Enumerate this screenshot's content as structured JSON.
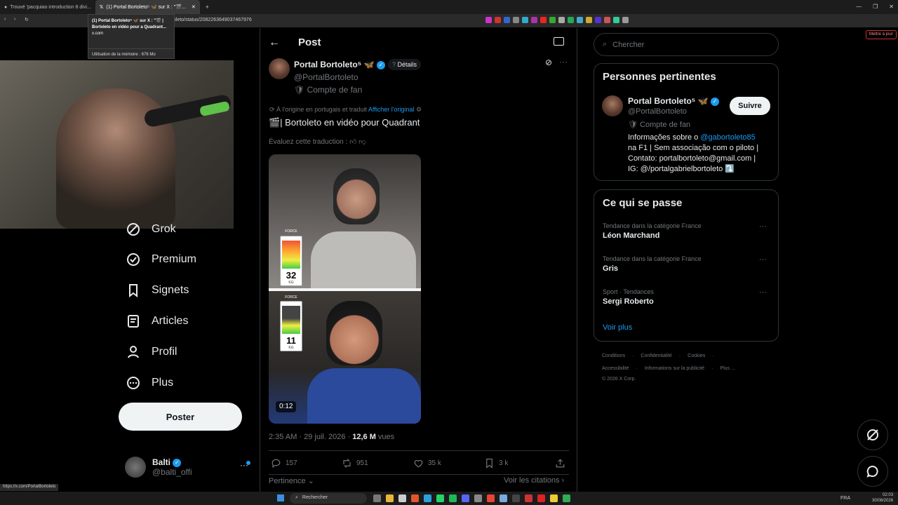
{
  "browser": {
    "tabs": [
      {
        "label": "Trouvé 'pacquiao introduction 8 divi..."
      },
      {
        "label": "(1) Portal Bortoleto⁵ 🦋 sur X : \"🎬..."
      }
    ],
    "url": "oleto/status/2082263649037467976",
    "tooltip": {
      "title": "(1) Portal Bortoleto⁵ 🦋 sur X : \"🎬 | Bortoleto en vidéo pour a Quadrant...",
      "domain": "x.com",
      "memory": "Utilisation de la mémoire : 676 Mo"
    },
    "update_button": "Mettre à jour",
    "status_url": "https://x.com/PortalBortoleto"
  },
  "colors": {
    "accent": "#1d9bf0",
    "bg": "#000000",
    "border": "#2f3336",
    "text": "#e7e9ea",
    "muted": "#71767b"
  },
  "sidebar": {
    "items": [
      {
        "label": "Grok",
        "icon": "grok-icon"
      },
      {
        "label": "Premium",
        "icon": "premium-icon"
      },
      {
        "label": "Signets",
        "icon": "bookmark-icon"
      },
      {
        "label": "Articles",
        "icon": "articles-icon"
      },
      {
        "label": "Profil",
        "icon": "profile-icon"
      },
      {
        "label": "Plus",
        "icon": "more-icon"
      }
    ],
    "post_button": "Poster",
    "account": {
      "name": "Balti",
      "handle": "@balti_offi"
    }
  },
  "post": {
    "header": "Post",
    "author": {
      "name": "Portal Bortoleto⁵ 🦋",
      "handle": "@PortalBortoleto",
      "tag": "🛡 Compte de fan"
    },
    "details": "Détails",
    "translation_note": "À l'origine en portugais et traduit",
    "show_original": "Afficher l'original",
    "text": "🎬| Bortoleto en vidéo pour Quadrant",
    "rate_translation": "Évaluez cette traduction :",
    "media": {
      "force_label": "FORCE",
      "kg_label": "KG",
      "top_value": "32",
      "bottom_value": "11",
      "duration": "0:12"
    },
    "timestamp": "2:35 AM · 29 juil. 2026 · ",
    "views": "12,6 M",
    "views_label": " vues",
    "stats": {
      "replies": "157",
      "reposts": "951",
      "likes": "35 k",
      "bookmarks": "3 k"
    },
    "sort": "Pertinence",
    "quotes": "Voir les citations"
  },
  "right": {
    "search_placeholder": "Chercher",
    "relevant": {
      "title": "Personnes pertinentes",
      "name": "Portal Bortoleto⁵ 🦋",
      "handle": "@PortalBortoleto",
      "tag": "🛡 Compte de fan",
      "follow": "Suivre",
      "bio1": "Informações sobre o ",
      "bio_link": "@gabortoleto85",
      "bio2": "na F1 | Sem associação com o piloto |",
      "bio3": "Contato: portalbortoleto@gmail.com |",
      "bio4": "IG: @/portalgabrielbortoleto ⤵️"
    },
    "trends": {
      "title": "Ce qui se passe",
      "items": [
        {
          "context": "Tendance dans la catégorie France",
          "name": "Léon Marchand"
        },
        {
          "context": "Tendance dans la catégorie France",
          "name": "Gris"
        },
        {
          "context": "Sport · Tendances",
          "name": "Sergi Roberto"
        }
      ],
      "more": "Voir plus"
    },
    "footer": {
      "line1": [
        "Conditions",
        "Confidentialité",
        "Cookies"
      ],
      "line2": [
        "Accessibilité",
        "Informations sur la publicité",
        "Plus ..."
      ],
      "copyright": "© 2026 X Corp."
    }
  },
  "taskbar": {
    "search": "Rechercher",
    "lang": "FRA",
    "time": "02:03",
    "date": "30/08/2026"
  }
}
